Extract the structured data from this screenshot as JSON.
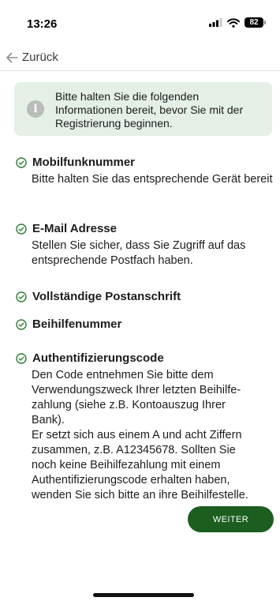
{
  "status_bar": {
    "time": "13:26",
    "battery": "82"
  },
  "nav": {
    "back_label": "Zurück"
  },
  "info_box": {
    "text": "Bitte halten Sie die folgenden Informationen bereit, bevor Sie mit der Registrierung beginnen."
  },
  "requirements": [
    {
      "title": "Mobilfunknummer",
      "desc": "Bitte halten Sie das entsprechende Gerät bereit"
    },
    {
      "title": "E-Mail Adresse",
      "desc": "Stellen Sie sicher, dass Sie Zugriff auf das entsprechende Postfach haben."
    },
    {
      "title": "Vollständige Postanschrift"
    },
    {
      "title": "Beihilfenummer"
    },
    {
      "title": "Authentifizierungscode",
      "desc_lines": [
        "Den Code entnehmen Sie bitte dem",
        "Verwendungszweck Ihrer letzten Beihilfe-",
        "zahlung (siehe z.B. Kontoauszug Ihrer",
        "Bank).",
        "Er setzt sich aus einem A und acht Ziffern",
        "zusammen, z.B. A12345678. Sollten Sie",
        "noch keine Beihilfezahlung mit einem",
        "Authentifizierungscode erhalten haben,",
        "wenden Sie sich bitte an ihre Beihilfestelle."
      ]
    }
  ],
  "actions": {
    "next_label": "WEITER"
  },
  "colors": {
    "accent": "#1b5e20",
    "info_bg": "#e4efe5",
    "check": "#2e7d32"
  }
}
